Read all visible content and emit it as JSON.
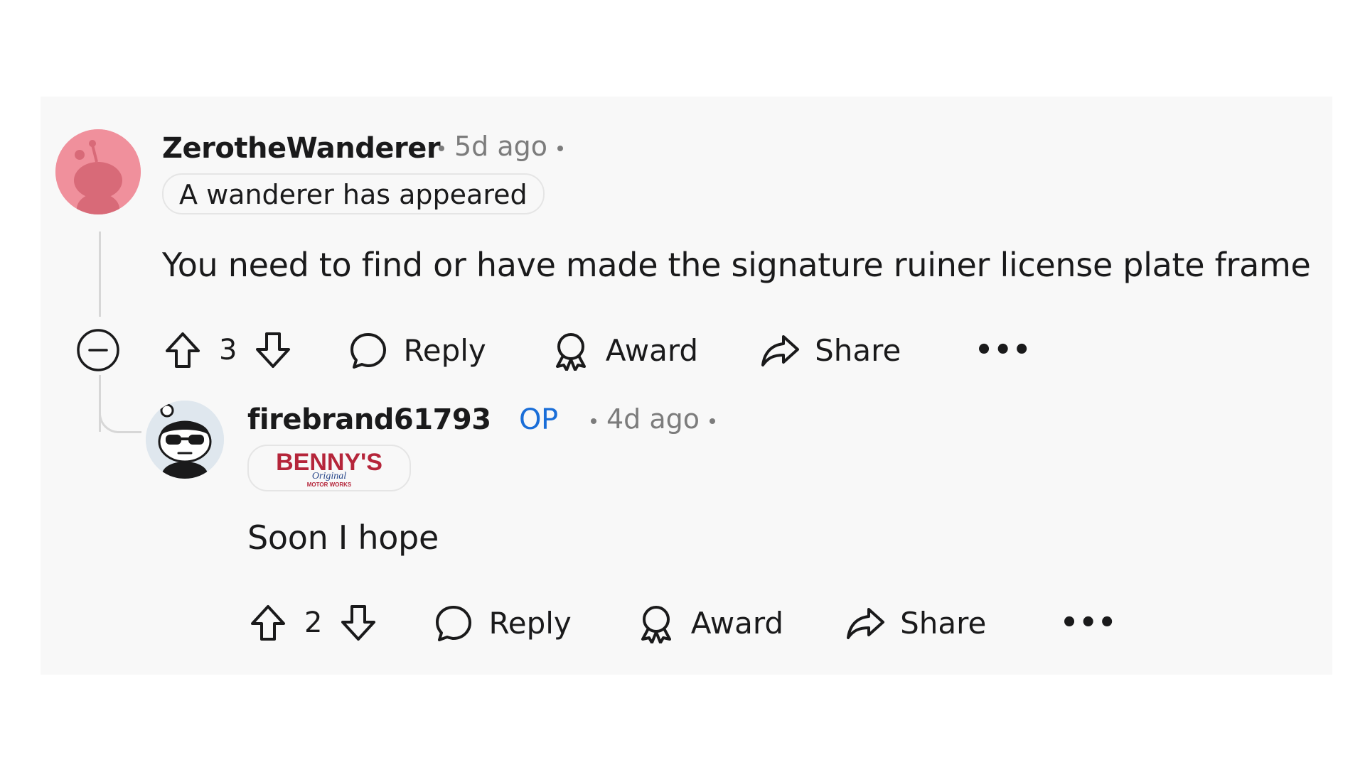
{
  "comments": [
    {
      "username": "ZerotheWanderer",
      "time": "5d ago",
      "flair": "A wanderer has appeared",
      "body": "You need to find or have made the signature ruiner license plate frame",
      "votes": "3",
      "reply_label": "Reply",
      "award_label": "Award",
      "share_label": "Share",
      "more_label": "•••",
      "avatar_color": "#e96b7c"
    },
    {
      "username": "firebrand61793",
      "op_label": "OP",
      "time": "4d ago",
      "flair_logo_text": "BENNY'S",
      "flair_logo_subtext": "Original",
      "flair_logo_small": "MOTOR WORKS",
      "body": "Soon I hope",
      "votes": "2",
      "reply_label": "Reply",
      "award_label": "Award",
      "share_label": "Share",
      "more_label": "•••"
    }
  ],
  "colors": {
    "op": "#1a6ed8",
    "panel_bg": "#f8f8f8",
    "meta": "#7c7c7c"
  }
}
